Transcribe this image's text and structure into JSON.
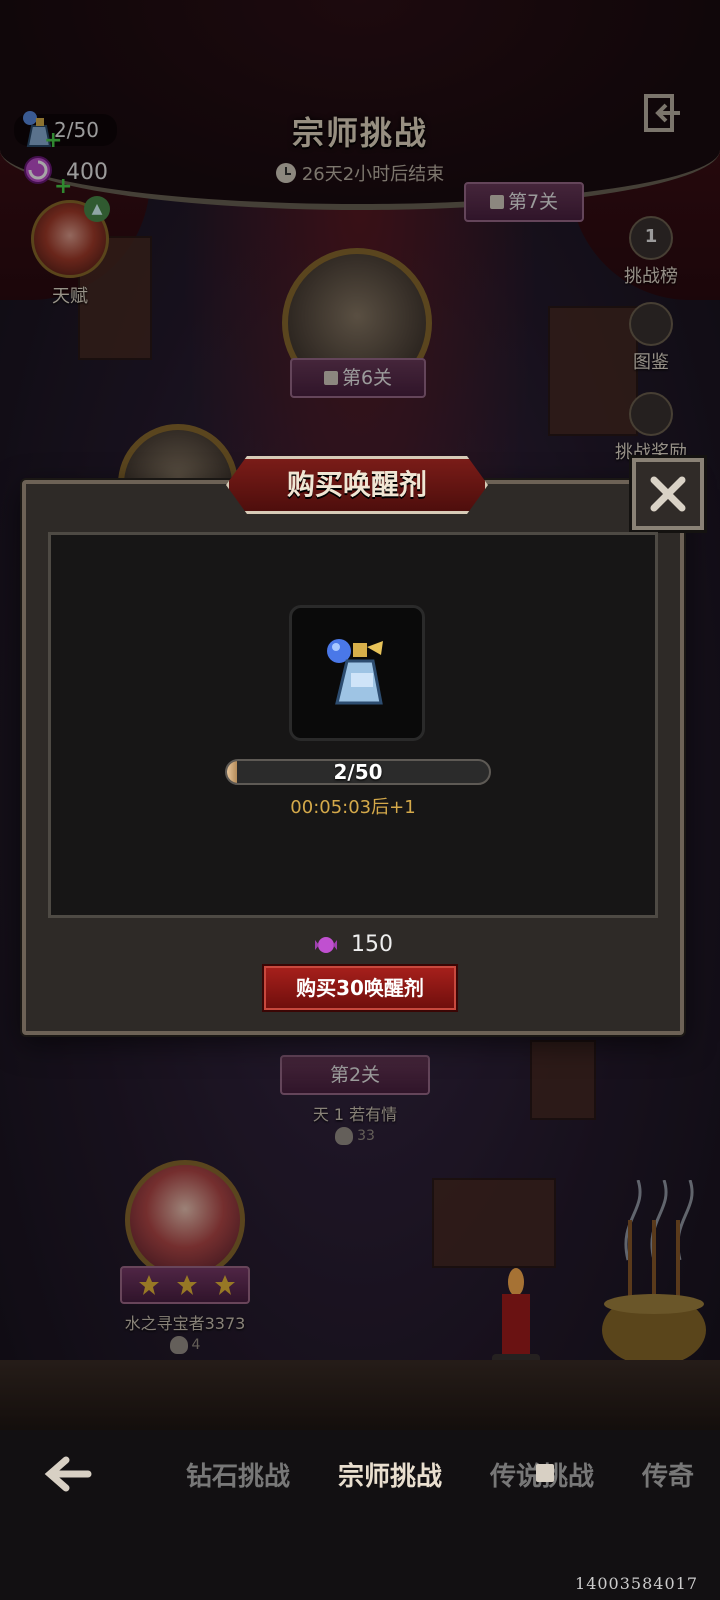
{
  "header": {
    "title": "宗师挑战",
    "timer": "26天2小时后结束"
  },
  "resources": {
    "potion_count": "2/50",
    "candy_count": "400"
  },
  "talent": {
    "label": "天赋"
  },
  "side_menu": [
    {
      "label": "挑战榜",
      "badge": "1"
    },
    {
      "label": "图鉴"
    },
    {
      "label": "挑战奖励"
    }
  ],
  "stages": {
    "stage7": "第7关",
    "stage6": "第6关",
    "stage2": "第2关",
    "stage2_owner": "天 1 若有情",
    "stage2_skulls": "33"
  },
  "dialog": {
    "title": "购买唤醒剂",
    "progress_text": "2/50",
    "progress_fraction": 0.04,
    "countdown": "00:05:03后+1",
    "cost": "150",
    "buy_label": "购买30唤醒剂"
  },
  "player": {
    "name": "水之寻宝者3373",
    "skulls": "4",
    "stars": 3
  },
  "bottom_nav": {
    "tabs": [
      "钻石挑战",
      "宗师挑战",
      "传说挑战",
      "传奇"
    ],
    "active": "宗师挑战"
  },
  "uid": "14003584017",
  "colors": {
    "accent_red": "#8e1a16",
    "gold_text": "#d4a94a",
    "dialog_bg": "#2e2a27"
  }
}
